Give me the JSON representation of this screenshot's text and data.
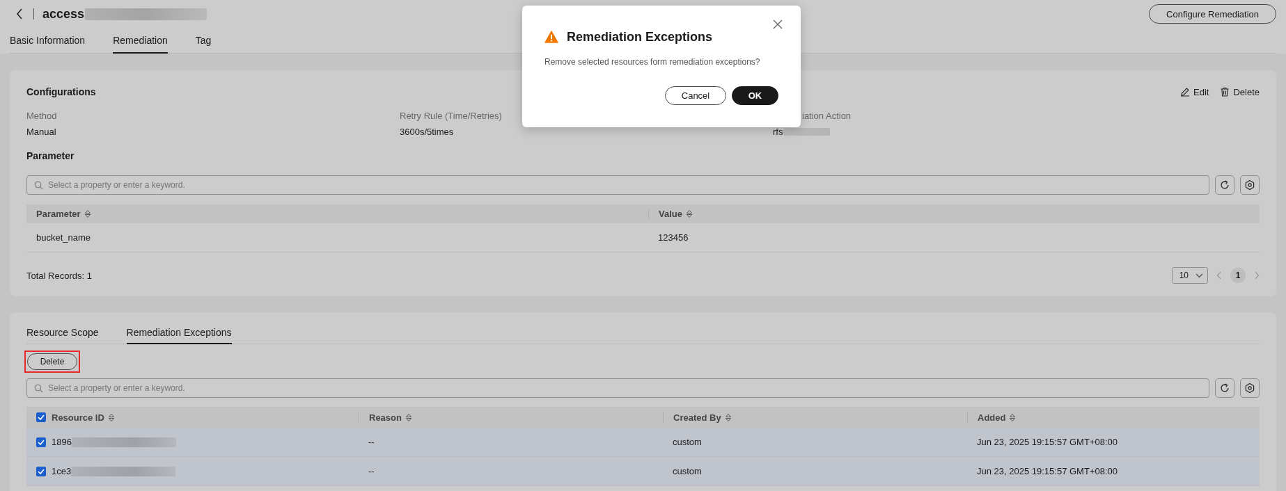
{
  "header": {
    "title": "access",
    "primary_button": "Configure Remediation"
  },
  "tabs": [
    {
      "label": "Basic Information",
      "selected": false
    },
    {
      "label": "Remediation",
      "selected": true
    },
    {
      "label": "Tag",
      "selected": false
    }
  ],
  "configurations": {
    "title": "Configurations",
    "actions": [
      {
        "kind": "edit",
        "label": "Edit"
      },
      {
        "kind": "delete",
        "label": "Delete"
      }
    ],
    "fields": [
      {
        "label": "Method",
        "value": "Manual",
        "cut_by_dialog": false
      },
      {
        "label": "Retry Rule (Time/Retries)",
        "value": "3600s/5times",
        "cut_by_dialog": false
      },
      {
        "label": "iation Action",
        "value": "rfs",
        "cut_by_dialog": true
      }
    ],
    "parameter_title": "Parameter",
    "search": {
      "placeholder": "Select a property or enter a keyword."
    },
    "table": {
      "columns": [
        "Parameter",
        "Value"
      ],
      "rows": [
        [
          "bucket_name",
          "123456"
        ]
      ]
    },
    "total": "Total Records: 1",
    "page_size": "10",
    "pages": [
      {
        "label": "1",
        "selected": true
      }
    ]
  },
  "exceptions": {
    "tabs": [
      {
        "label": "Resource Scope",
        "selected": false
      },
      {
        "label": "Remediation Exceptions",
        "selected": true
      }
    ],
    "delete_button": "Delete",
    "delete_highlighted": true,
    "search": {
      "placeholder": "Select a property or enter a keyword."
    },
    "table": {
      "all_checked": true,
      "columns": [
        "Resource ID",
        "Reason",
        "Created By",
        "Added"
      ],
      "rows": [
        {
          "checked": true,
          "cells": [
            "1896",
            "--",
            "custom",
            "Jun 23, 2025 19:15:57 GMT+08:00"
          ]
        },
        {
          "checked": true,
          "cells": [
            "1ce3",
            "--",
            "custom",
            "Jun 23, 2025 19:15:57 GMT+08:00"
          ]
        }
      ]
    }
  },
  "dialog": {
    "title": "Remediation Exceptions",
    "message": "Remove selected resources form remediation exceptions?",
    "buttons": [
      {
        "kind": "secondary",
        "label": "Cancel"
      },
      {
        "kind": "primary",
        "label": "OK"
      }
    ]
  }
}
